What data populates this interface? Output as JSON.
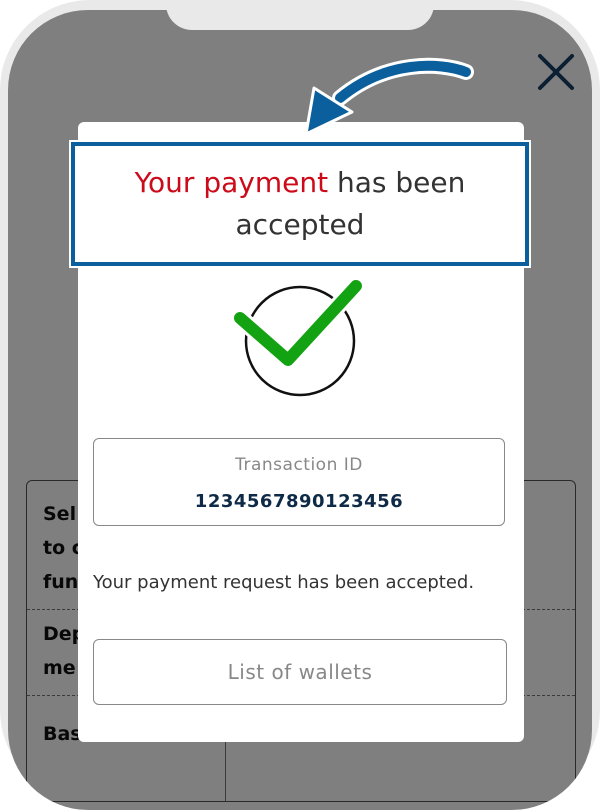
{
  "background_table": {
    "rows": [
      {
        "label": "Sel\nto c\nfun"
      },
      {
        "label": "Dep\nme"
      },
      {
        "label": "Bas"
      }
    ]
  },
  "close_icon": "close-icon",
  "arrow_icon": "curved-arrow-icon",
  "headline": {
    "highlight": "Your payment",
    "rest": " has been",
    "line2": "accepted",
    "highlight_color": "#cc0a1a",
    "border_color": "#0b5f9c"
  },
  "check_icon": {
    "name": "checkmark-icon",
    "color": "#12a212"
  },
  "transaction": {
    "label": "Transaction ID",
    "value": "1234567890123456"
  },
  "message": "Your payment request has been accepted.",
  "wallets_button": {
    "label": "List of wallets"
  }
}
